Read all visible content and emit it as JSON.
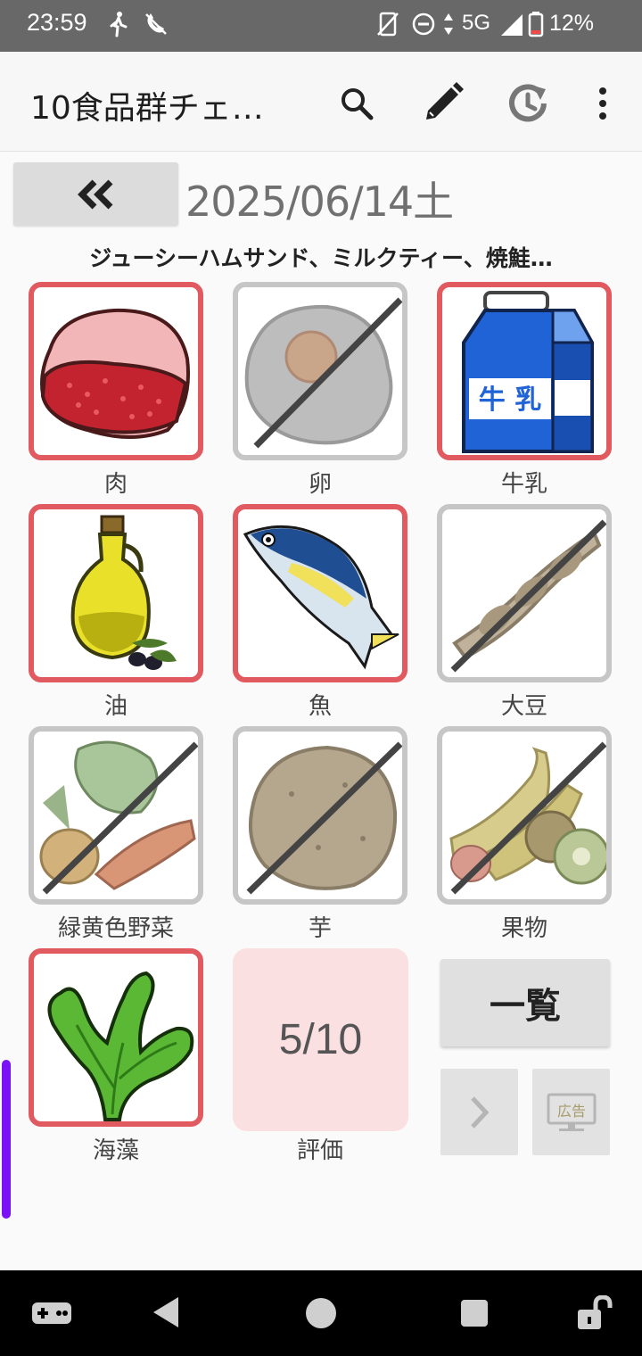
{
  "status_bar": {
    "time": "23:59",
    "network": "5G",
    "battery": "12%"
  },
  "app_bar": {
    "title": "10食品群チェ…",
    "icons": [
      "search-icon",
      "edit-icon",
      "history-icon",
      "more-vert-icon"
    ]
  },
  "date_row": {
    "prev_label": "«",
    "date": "2025/06/14土"
  },
  "meals_text": "ジューシーハムサンド、ミルクティー、焼鮭…",
  "food_groups": [
    {
      "label": "肉",
      "checked": true
    },
    {
      "label": "卵",
      "checked": false
    },
    {
      "label": "牛乳",
      "checked": true
    },
    {
      "label": "油",
      "checked": true
    },
    {
      "label": "魚",
      "checked": true
    },
    {
      "label": "大豆",
      "checked": false
    },
    {
      "label": "緑黄色野菜",
      "checked": false
    },
    {
      "label": "芋",
      "checked": false
    },
    {
      "label": "果物",
      "checked": false
    },
    {
      "label": "海藻",
      "checked": true
    }
  ],
  "milk_carton_text": "牛 乳",
  "score": {
    "value": "5/10",
    "label": "評価"
  },
  "buttons": {
    "list_label": "一覧",
    "ad_label": "広告"
  },
  "colors": {
    "checked_border": "#e05a5f",
    "unchecked_border": "#c6c6c6",
    "score_bg": "#fbe0e2",
    "scroll_indicator": "#7a12f5"
  }
}
